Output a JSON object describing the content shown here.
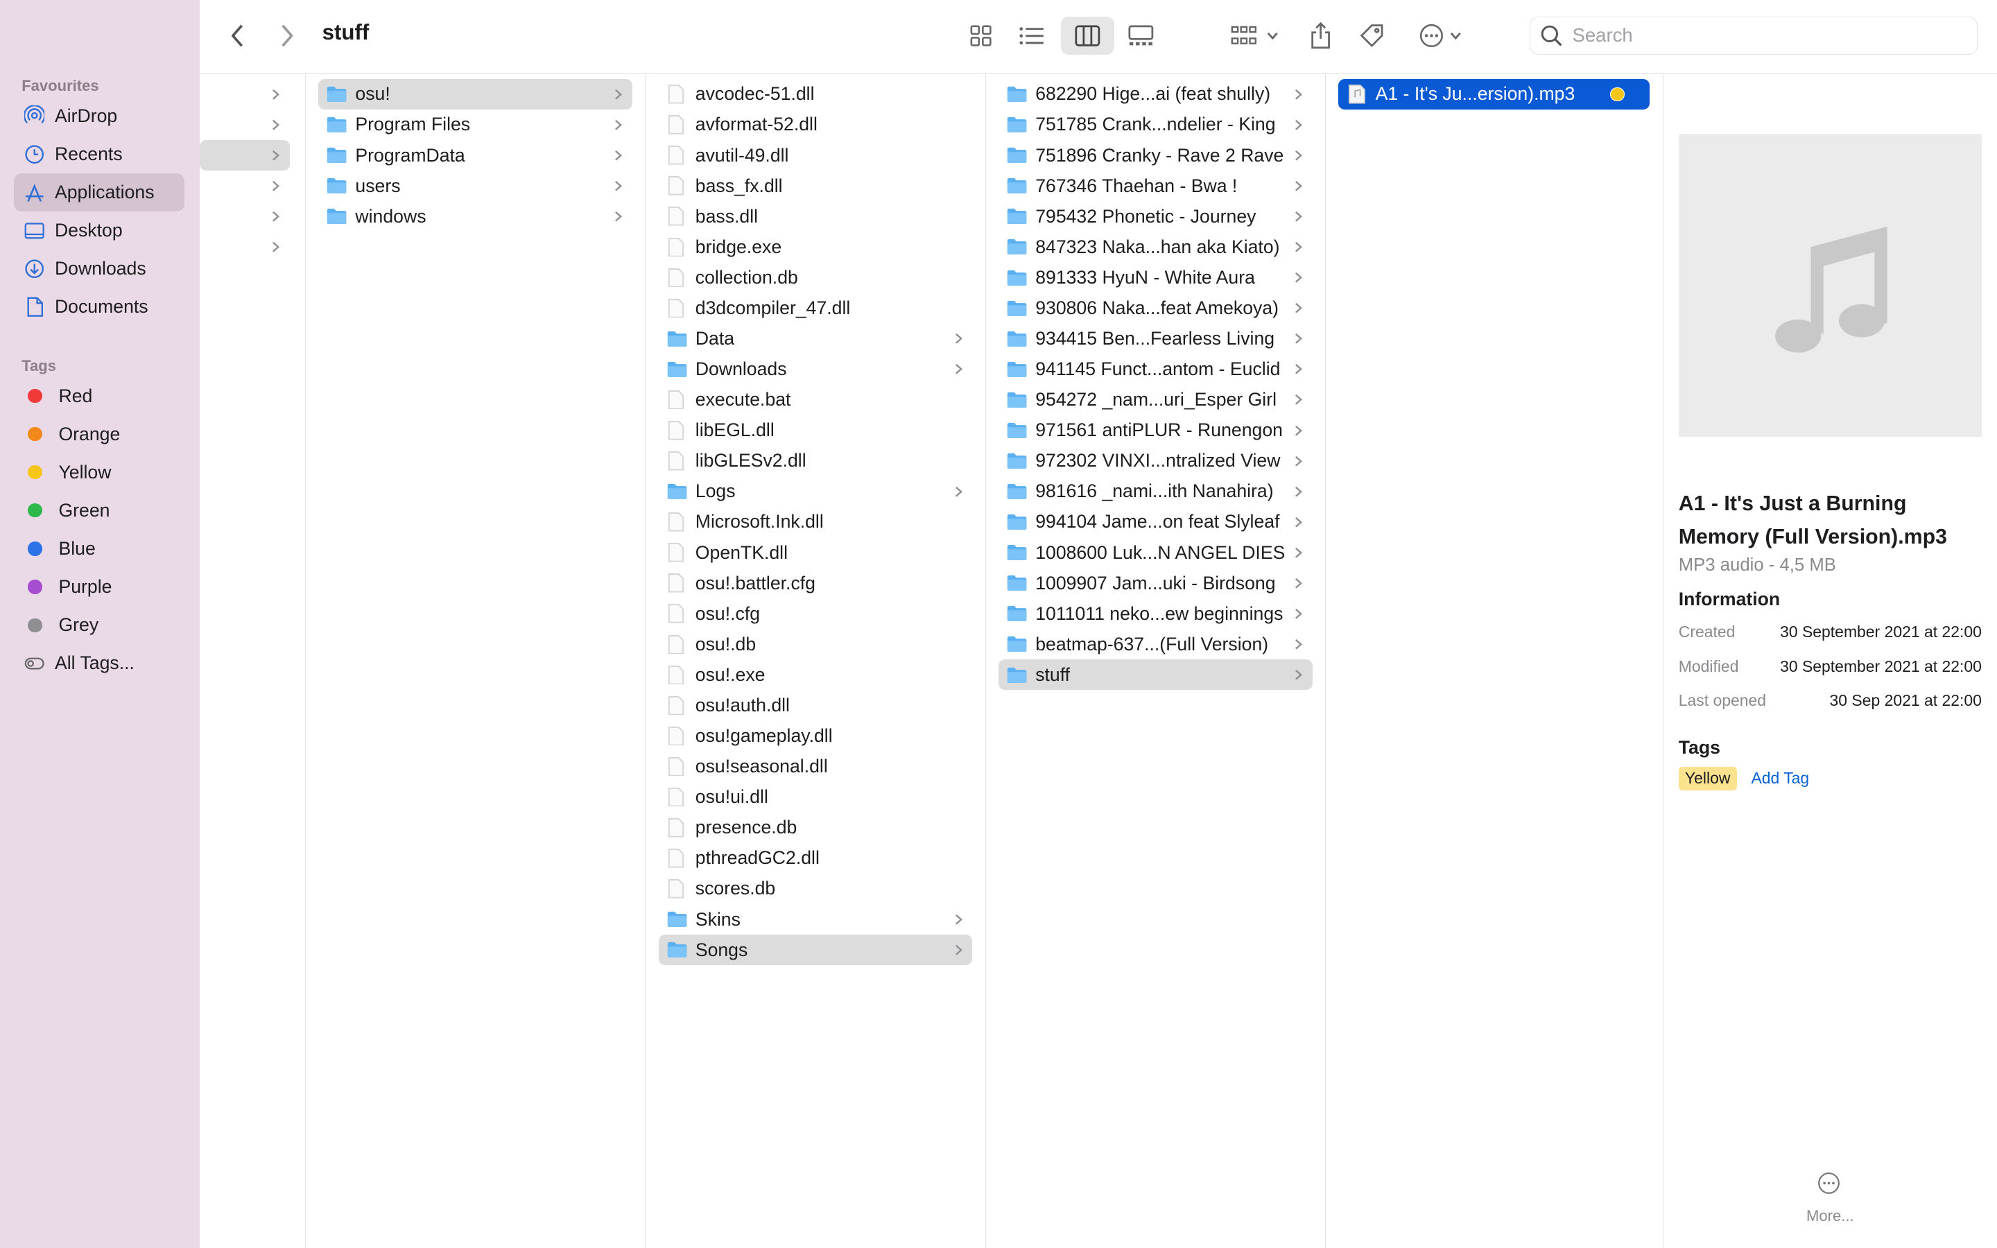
{
  "sidebar": {
    "favourites_title": "Favourites",
    "favourites": [
      {
        "label": "AirDrop",
        "icon": "airdrop-icon"
      },
      {
        "label": "Recents",
        "icon": "clock-icon"
      },
      {
        "label": "Applications",
        "icon": "applications-icon"
      },
      {
        "label": "Desktop",
        "icon": "desktop-icon"
      },
      {
        "label": "Downloads",
        "icon": "download-icon"
      },
      {
        "label": "Documents",
        "icon": "document-icon"
      }
    ],
    "tags_title": "Tags",
    "tags": [
      {
        "label": "Red",
        "color": "#f03a3a"
      },
      {
        "label": "Orange",
        "color": "#f2891a"
      },
      {
        "label": "Yellow",
        "color": "#f5c518"
      },
      {
        "label": "Green",
        "color": "#2fb84a"
      },
      {
        "label": "Blue",
        "color": "#2a73e8"
      },
      {
        "label": "Purple",
        "color": "#a54fd0"
      },
      {
        "label": "Grey",
        "color": "#8e8e93"
      }
    ],
    "all_tags_label": "All Tags..."
  },
  "toolbar": {
    "title": "stuff",
    "search_placeholder": "Search"
  },
  "columns": {
    "col2": [
      {
        "name": "osu!",
        "type": "folder"
      },
      {
        "name": "Program Files",
        "type": "folder"
      },
      {
        "name": "ProgramData",
        "type": "folder"
      },
      {
        "name": "users",
        "type": "folder"
      },
      {
        "name": "windows",
        "type": "folder"
      }
    ],
    "col3": [
      {
        "name": "avcodec-51.dll",
        "type": "file"
      },
      {
        "name": "avformat-52.dll",
        "type": "file"
      },
      {
        "name": "avutil-49.dll",
        "type": "file"
      },
      {
        "name": "bass_fx.dll",
        "type": "file"
      },
      {
        "name": "bass.dll",
        "type": "file"
      },
      {
        "name": "bridge.exe",
        "type": "file"
      },
      {
        "name": "collection.db",
        "type": "file"
      },
      {
        "name": "d3dcompiler_47.dll",
        "type": "file"
      },
      {
        "name": "Data",
        "type": "folder"
      },
      {
        "name": "Downloads",
        "type": "folder"
      },
      {
        "name": "execute.bat",
        "type": "file"
      },
      {
        "name": "libEGL.dll",
        "type": "file"
      },
      {
        "name": "libGLESv2.dll",
        "type": "file"
      },
      {
        "name": "Logs",
        "type": "folder"
      },
      {
        "name": "Microsoft.Ink.dll",
        "type": "file"
      },
      {
        "name": "OpenTK.dll",
        "type": "file"
      },
      {
        "name": "osu!.battler.cfg",
        "type": "file"
      },
      {
        "name": "osu!.cfg",
        "type": "file"
      },
      {
        "name": "osu!.db",
        "type": "file"
      },
      {
        "name": "osu!.exe",
        "type": "file"
      },
      {
        "name": "osu!auth.dll",
        "type": "file"
      },
      {
        "name": "osu!gameplay.dll",
        "type": "file"
      },
      {
        "name": "osu!seasonal.dll",
        "type": "file"
      },
      {
        "name": "osu!ui.dll",
        "type": "file"
      },
      {
        "name": "presence.db",
        "type": "file"
      },
      {
        "name": "pthreadGC2.dll",
        "type": "file"
      },
      {
        "name": "scores.db",
        "type": "file"
      },
      {
        "name": "Skins",
        "type": "folder"
      },
      {
        "name": "Songs",
        "type": "folder"
      }
    ],
    "col4": [
      {
        "name": "682290 Hige...ai (feat shully)",
        "type": "folder"
      },
      {
        "name": "751785 Crank...ndelier - King",
        "type": "folder"
      },
      {
        "name": "751896 Cranky - Rave 2 Rave",
        "type": "folder"
      },
      {
        "name": "767346 Thaehan - Bwa !",
        "type": "folder"
      },
      {
        "name": "795432 Phonetic - Journey",
        "type": "folder"
      },
      {
        "name": "847323 Naka...han aka Kiato)",
        "type": "folder"
      },
      {
        "name": "891333 HyuN - White Aura",
        "type": "folder"
      },
      {
        "name": "930806 Naka...feat Amekoya)",
        "type": "folder"
      },
      {
        "name": "934415 Ben...Fearless Living",
        "type": "folder"
      },
      {
        "name": "941145 Funct...antom - Euclid",
        "type": "folder"
      },
      {
        "name": "954272 _nam...uri_Esper Girl",
        "type": "folder"
      },
      {
        "name": "971561 antiPLUR - Runengon",
        "type": "folder"
      },
      {
        "name": "972302 VINXI...ntralized View",
        "type": "folder"
      },
      {
        "name": "981616 _nami...ith Nanahira)",
        "type": "folder"
      },
      {
        "name": "994104 Jame...on feat Slyleaf",
        "type": "folder"
      },
      {
        "name": "1008600 Luk...N ANGEL DIES",
        "type": "folder"
      },
      {
        "name": "1009907 Jam...uki - Birdsong",
        "type": "folder"
      },
      {
        "name": "1011011 neko...ew beginnings",
        "type": "folder"
      },
      {
        "name": "beatmap-637...(Full Version)",
        "type": "folder"
      },
      {
        "name": "stuff",
        "type": "folder"
      }
    ],
    "col5": [
      {
        "name": "A1 - It's Ju...ersion).mp3",
        "type": "audio",
        "tag_color": "#f5c518"
      }
    ]
  },
  "preview": {
    "title": "A1 - It's Just a Burning Memory (Full Version).mp3",
    "subtitle": "MP3 audio - 4,5 MB",
    "info_heading": "Information",
    "info": [
      {
        "key": "Created",
        "value": "30 September 2021 at 22:00"
      },
      {
        "key": "Modified",
        "value": "30 September 2021 at 22:00"
      },
      {
        "key": "Last opened",
        "value": "30 Sep 2021 at 22:00"
      }
    ],
    "tags_heading": "Tags",
    "tag": "Yellow",
    "add_tag": "Add Tag",
    "more": "More..."
  }
}
